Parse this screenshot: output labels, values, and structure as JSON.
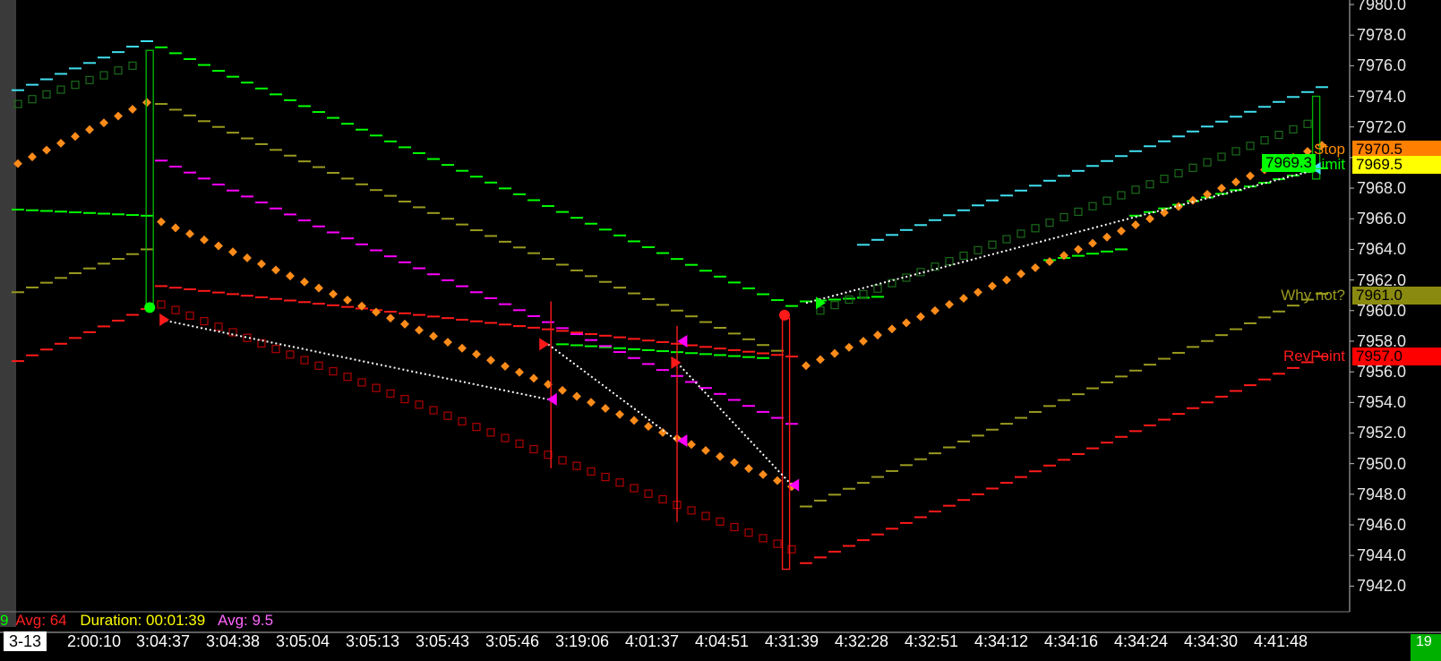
{
  "chart_data": {
    "type": "line",
    "ylim": [
      7940.5,
      7980.0
    ],
    "y_ticks": [
      "7980.0",
      "7978.0",
      "7976.0",
      "7974.0",
      "7972.0",
      "7970.0",
      "7968.0",
      "7966.0",
      "7964.0",
      "7962.0",
      "7960.0",
      "7958.0",
      "7956.0",
      "7954.0",
      "7952.0",
      "7950.0",
      "7948.0",
      "7946.0",
      "7944.0",
      "7942.0"
    ],
    "x_ticks": [
      "3-13",
      "2:00:10",
      "3:04:37",
      "3:04:38",
      "3:05:04",
      "3:05:13",
      "3:05:43",
      "3:05:46",
      "3:19:06",
      "4:01:37",
      "4:04:51",
      "4:31:39",
      "4:32:28",
      "4:32:51",
      "4:34:12",
      "4:34:16",
      "4:34:24",
      "4:34:30",
      "4:41:48"
    ],
    "grid": false,
    "status_bar": {
      "left_fragment": "9",
      "avg1": "Avg: 64",
      "duration": "Duration: 00:01:39",
      "avg2": "Avg: 9.5"
    },
    "levels": [
      {
        "label": "Stop",
        "value_text": "7970.5",
        "value": 7970.5,
        "label_color": "#ff8c00",
        "box_color": "#ff7f00",
        "text_color": "#000000"
      },
      {
        "label": "Limit",
        "value_text": "7969.5",
        "value": 7969.5,
        "label_color": "#00ff00",
        "box_color": "#ffff00",
        "text_color": "#000000"
      },
      {
        "label": "Why not?",
        "value_text": "7961.0",
        "value": 7961.0,
        "label_color": "#9a9a20",
        "box_color": "#8a8a10",
        "text_color": "#000000"
      },
      {
        "label": "RevPoint",
        "value_text": "7957.0",
        "value": 7957.0,
        "label_color": "#ff1a1a",
        "box_color": "#ff0000",
        "text_color": "#000000"
      }
    ],
    "position_box": {
      "value_text": "7969.3",
      "color": "#00ff00"
    },
    "corner_label": "19",
    "colors": {
      "cyan": "#40e0f0",
      "green": "#00ff00",
      "olive": "#9a9a20",
      "magenta": "#ff00ff",
      "red": "#ff1a1a",
      "orange": "#ff8c1a",
      "dark_red": "#b00000",
      "dark_green": "#1b6b1b",
      "trade_line": "#ffffff"
    },
    "series": [
      {
        "name": "cyan",
        "style": "dash",
        "segments": [
          [
            [
              0,
              7974.4
            ],
            [
              9,
              7977.6
            ]
          ],
          [
            [
              59,
              7964.3
            ],
            [
              91,
              7974.6
            ]
          ]
        ]
      },
      {
        "name": "green",
        "style": "dash",
        "segments": [
          [
            [
              10,
              7977.2
            ],
            [
              54,
              7960.3
            ]
          ],
          [
            [
              55,
              7960.6
            ],
            [
              60,
              7960.9
            ]
          ],
          [
            [
              72,
              7963.3
            ],
            [
              77,
              7964.0
            ]
          ],
          [
            [
              0,
              7966.6
            ],
            [
              9,
              7966.2
            ]
          ],
          [
            [
              78,
              7966.2
            ],
            [
              91,
              7969.3
            ]
          ],
          [
            [
              38,
              7957.8
            ],
            [
              52,
              7956.9
            ]
          ]
        ]
      },
      {
        "name": "olive",
        "style": "dash",
        "segments": [
          [
            [
              0,
              7961.2
            ],
            [
              9,
              7964.0
            ]
          ],
          [
            [
              10,
              7973.5
            ],
            [
              54,
              7957.0
            ]
          ],
          [
            [
              55,
              7947.2
            ],
            [
              91,
              7961.1
            ]
          ]
        ]
      },
      {
        "name": "magenta",
        "style": "dash",
        "segments": [
          [
            [
              10,
              7969.8
            ],
            [
              54,
              7952.6
            ]
          ]
        ]
      },
      {
        "name": "red",
        "style": "dash",
        "segments": [
          [
            [
              0,
              7956.7
            ],
            [
              9,
              7960.1
            ]
          ],
          [
            [
              10,
              7961.6
            ],
            [
              54,
              7957.0
            ]
          ],
          [
            [
              55,
              7943.5
            ],
            [
              91,
              7957.0
            ]
          ]
        ]
      },
      {
        "name": "orange",
        "style": "dots",
        "segments": [
          [
            [
              0,
              7969.6
            ],
            [
              9,
              7973.6
            ]
          ],
          [
            [
              10,
              7965.8
            ],
            [
              54,
              7948.5
            ]
          ],
          [
            [
              55,
              7956.4
            ],
            [
              91,
              7970.8
            ]
          ]
        ]
      },
      {
        "name": "dark_red",
        "style": "squares",
        "segments": [
          [
            [
              10,
              7960.4
            ],
            [
              54,
              7944.4
            ]
          ]
        ]
      },
      {
        "name": "dark_green",
        "style": "squares",
        "segments": [
          [
            [
              0,
              7973.5
            ],
            [
              8,
              7976.0
            ]
          ],
          [
            [
              56,
              7960.0
            ],
            [
              90,
              7972.2
            ]
          ]
        ]
      }
    ],
    "trade_lines": [
      [
        [
          10,
          7959.4
        ],
        [
          37,
          7954.2
        ]
      ],
      [
        [
          37,
          7957.8
        ],
        [
          46,
          7951.5
        ]
      ],
      [
        [
          46,
          7956.6
        ],
        [
          54,
          7948.6
        ]
      ],
      [
        [
          55,
          7960.5
        ],
        [
          91,
          7969.3
        ]
      ]
    ],
    "markers": [
      {
        "type": "circle",
        "x": 9.2,
        "y": 7960.2,
        "color": "#00ff00"
      },
      {
        "type": "circle",
        "x": 53.5,
        "y": 7959.7,
        "color": "#ff1a1a"
      },
      {
        "type": "tri-right",
        "x": 10.2,
        "y": 7959.4,
        "color": "#ff1a1a"
      },
      {
        "type": "tri-left",
        "x": 37.3,
        "y": 7954.2,
        "color": "#ff00ff"
      },
      {
        "type": "tri-right",
        "x": 36.7,
        "y": 7957.8,
        "color": "#ff1a1a"
      },
      {
        "type": "tri-left",
        "x": 46.4,
        "y": 7951.5,
        "color": "#ff00ff"
      },
      {
        "type": "tri-left",
        "x": 46.4,
        "y": 7958.0,
        "color": "#ff00ff"
      },
      {
        "type": "tri-right",
        "x": 45.9,
        "y": 7956.6,
        "color": "#ff1a1a"
      },
      {
        "type": "tri-left",
        "x": 54.2,
        "y": 7948.6,
        "color": "#ff00ff"
      },
      {
        "type": "tri-right",
        "x": 56.0,
        "y": 7960.5,
        "color": "#00ff00"
      },
      {
        "type": "tri-left",
        "x": 90.6,
        "y": 7969.3,
        "color": "#40e0f0"
      }
    ],
    "big_bars": [
      {
        "x": 9.2,
        "open": 7977.0,
        "close": 7960.2,
        "color": "#00b000"
      },
      {
        "x": 53.6,
        "open": 7959.5,
        "close": 7943.1,
        "color": "#ff1a1a"
      },
      {
        "x": 37.2,
        "high": 7960.6,
        "low": 7949.7,
        "color": "#ff1a1a"
      },
      {
        "x": 46.0,
        "high": 7959.0,
        "low": 7946.2,
        "color": "#ff1a1a"
      },
      {
        "x": 90.6,
        "open": 7974.0,
        "close": 7968.6,
        "color": "#00b000"
      }
    ]
  }
}
